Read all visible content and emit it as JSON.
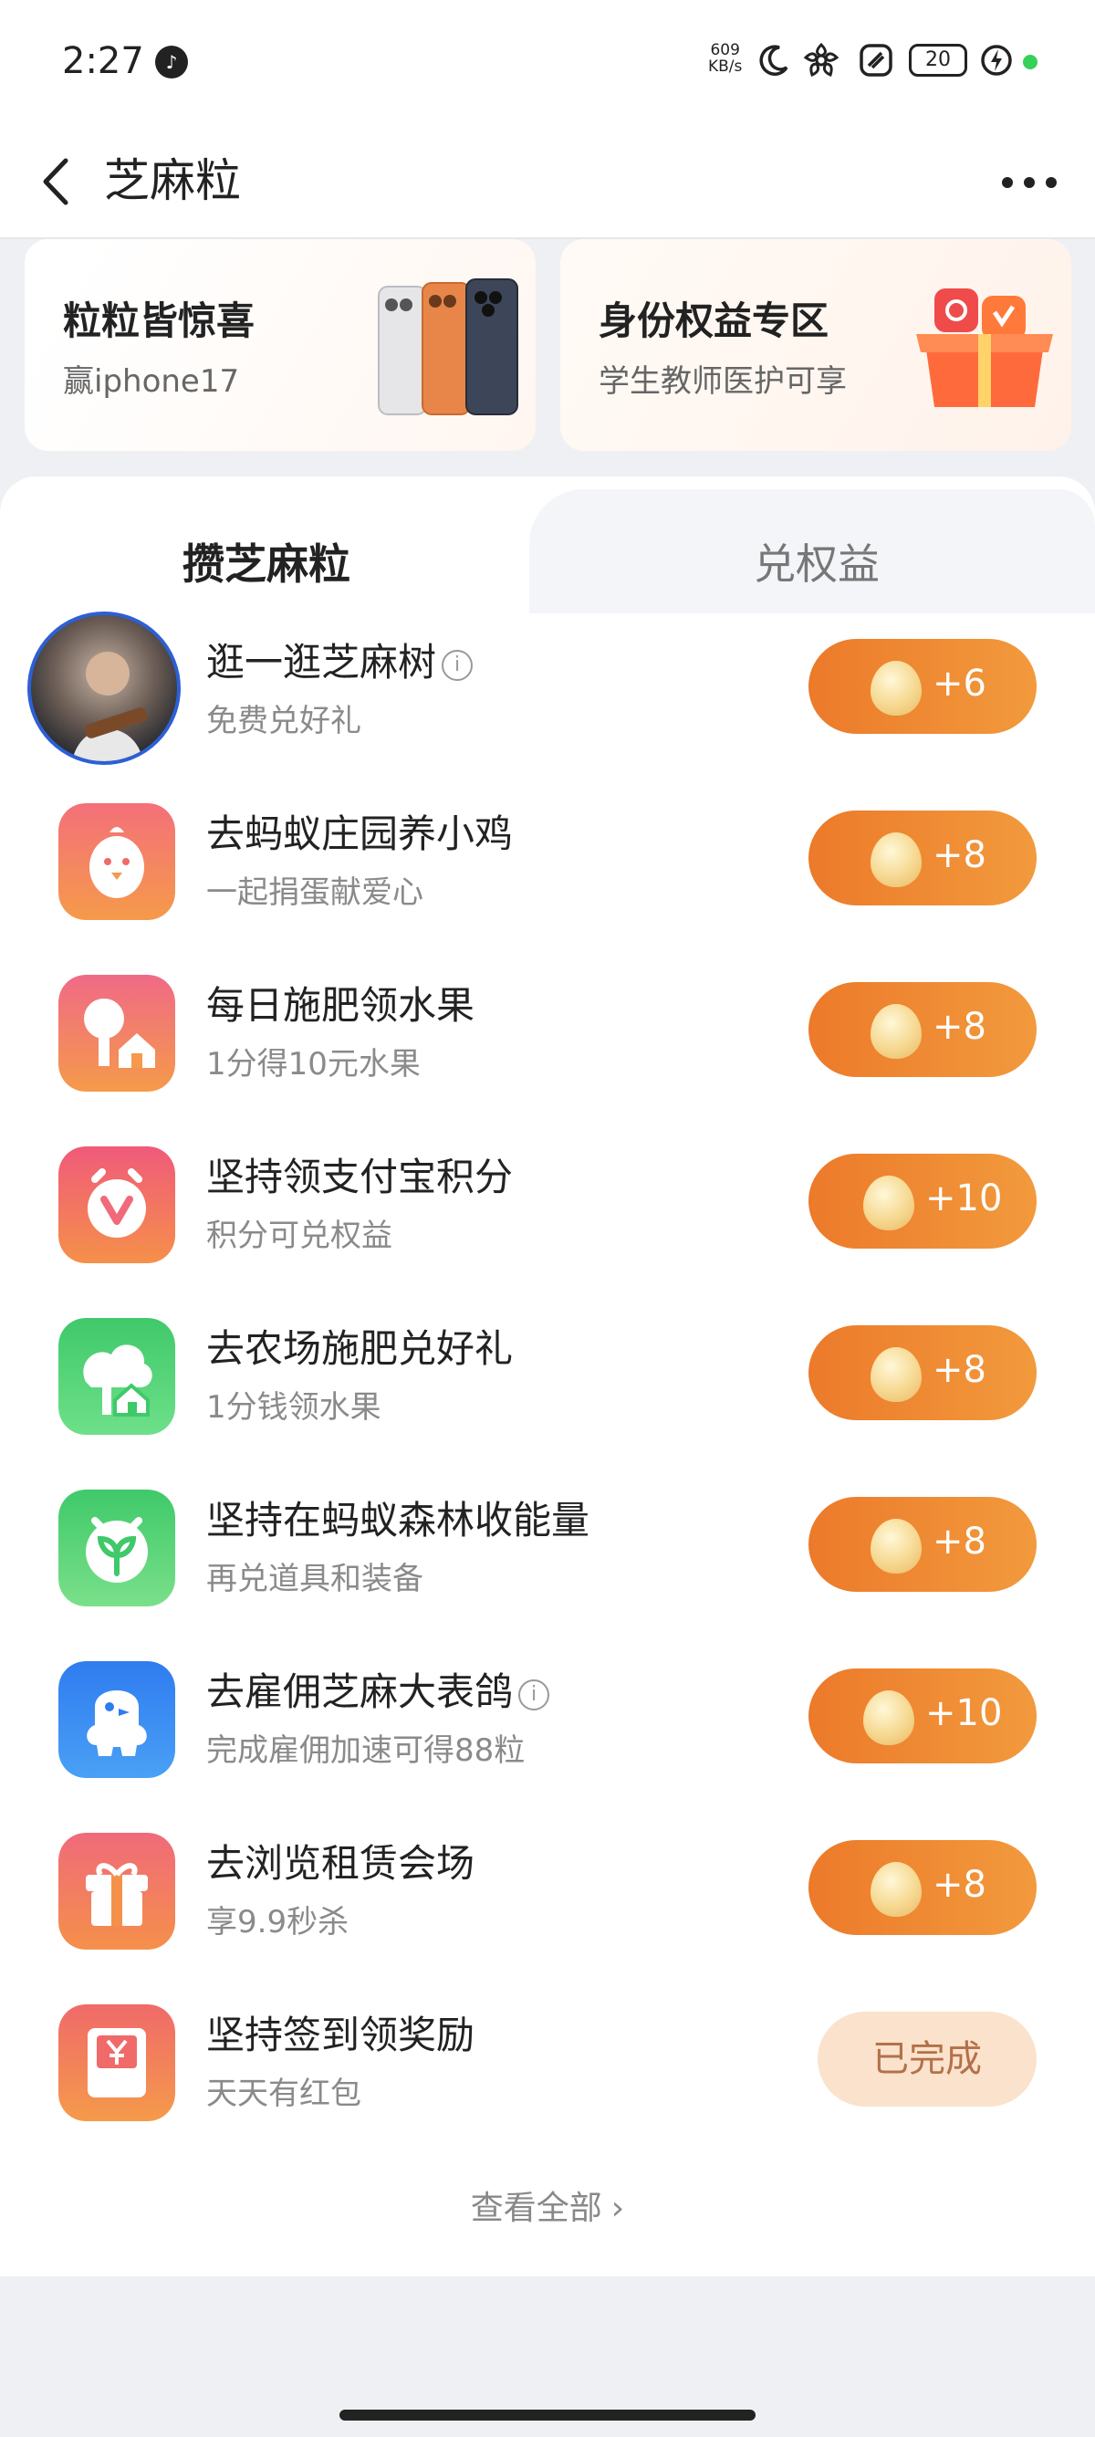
{
  "status_bar": {
    "time": "2:27",
    "net_speed_value": "609",
    "net_speed_unit": "KB/s",
    "battery": "20"
  },
  "nav": {
    "title": "芝麻粒"
  },
  "promo": {
    "left": {
      "title": "粒粒皆惊喜",
      "subtitle": "赢iphone17"
    },
    "right": {
      "title": "身份权益专区",
      "subtitle": "学生教师医护可享"
    }
  },
  "tabs": [
    {
      "label": "攒芝麻粒",
      "active": true
    },
    {
      "label": "兑权益",
      "active": false
    }
  ],
  "tasks": [
    {
      "title": "逛一逛芝麻树",
      "subtitle": "免费兑好礼",
      "reward": "+6",
      "info": true,
      "icon": "avatar-photo"
    },
    {
      "title": "去蚂蚁庄园养小鸡",
      "subtitle": "一起捐蛋献爱心",
      "reward": "+8",
      "icon": "chick-icon"
    },
    {
      "title": "每日施肥领水果",
      "subtitle": "1分得10元水果",
      "reward": "+8",
      "icon": "fruit-tree-icon"
    },
    {
      "title": "坚持领支付宝积分",
      "subtitle": "积分可兑权益",
      "reward": "+10",
      "icon": "points-badge-icon"
    },
    {
      "title": "去农场施肥兑好礼",
      "subtitle": "1分钱领水果",
      "reward": "+8",
      "icon": "farm-house-icon"
    },
    {
      "title": "坚持在蚂蚁森林收能量",
      "subtitle": "再兑道具和装备",
      "reward": "+8",
      "icon": "forest-sprout-icon"
    },
    {
      "title": "去雇佣芝麻大表鸽",
      "subtitle": "完成雇佣加速可得88粒",
      "reward": "+10",
      "info": true,
      "icon": "pigeon-icon"
    },
    {
      "title": "去浏览租赁会场",
      "subtitle": "享9.9秒杀",
      "reward": "+8",
      "icon": "gift-box-icon"
    },
    {
      "title": "坚持签到领奖励",
      "subtitle": "天天有红包",
      "done_label": "已完成",
      "icon": "red-packet-icon"
    }
  ],
  "view_all": "查看全部",
  "colors": {
    "accent_orange": "#ec7a2a",
    "done_bg": "#fbe2cc",
    "page_bg": "#eff0f4"
  }
}
